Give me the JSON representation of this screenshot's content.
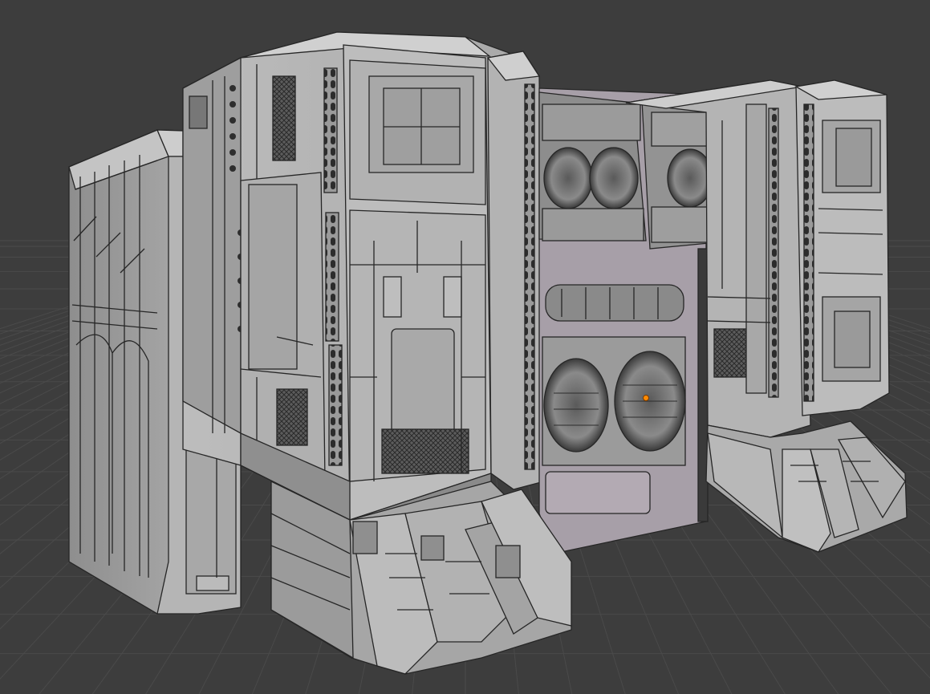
{
  "viewport": {
    "background": "#3d3d3d",
    "grid_color": "#4a4a4a",
    "wire_color": "#262626",
    "mesh_face": "#b7b7b7",
    "mesh_shadow": "#9a9a9a",
    "mesh_light": "#cfcfcf",
    "accent_tint": "#b8aeb8",
    "origin_color": "#ff8a00"
  }
}
